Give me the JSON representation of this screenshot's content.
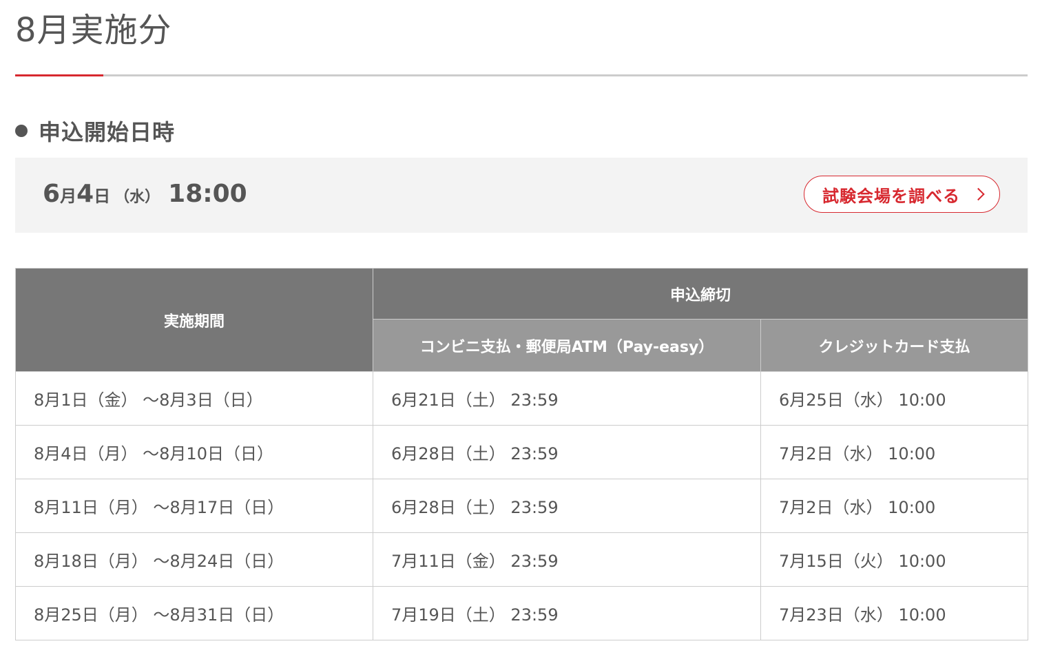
{
  "page": {
    "title": "8月実施分"
  },
  "start_section": {
    "heading": "申込開始日時",
    "month_day": [
      "6",
      "月",
      "4",
      "日"
    ],
    "weekday": "（水）",
    "time": "18:00",
    "venue_button_label": "試験会場を調べる"
  },
  "table": {
    "headers": {
      "period": "実施期間",
      "deadline": "申込締切",
      "convenience": "コンビニ支払・郵便局ATM（Pay-easy）",
      "credit": "クレジットカード支払"
    },
    "rows": [
      {
        "period": "8月1日（金） ～8月3日（日）",
        "convenience": "6月21日（土） 23:59",
        "credit": "6月25日（水） 10:00"
      },
      {
        "period": "8月4日（月） ～8月10日（日）",
        "convenience": "6月28日（土） 23:59",
        "credit": "7月2日（水） 10:00"
      },
      {
        "period": "8月11日（月） ～8月17日（日）",
        "convenience": "6月28日（土） 23:59",
        "credit": "7月2日（水） 10:00"
      },
      {
        "period": "8月18日（月） ～8月24日（日）",
        "convenience": "7月11日（金） 23:59",
        "credit": "7月15日（火） 10:00"
      },
      {
        "period": "8月25日（月） ～8月31日（日）",
        "convenience": "7月19日（土） 23:59",
        "credit": "7月23日（水） 10:00"
      }
    ]
  },
  "colors": {
    "accent": "#d7282f",
    "text": "#555555",
    "header_dark": "#777777",
    "header_light": "#999999",
    "box_background": "#f3f3f3"
  },
  "icons": {
    "bullet": "bullet-icon",
    "chevron": "chevron-right-icon"
  }
}
